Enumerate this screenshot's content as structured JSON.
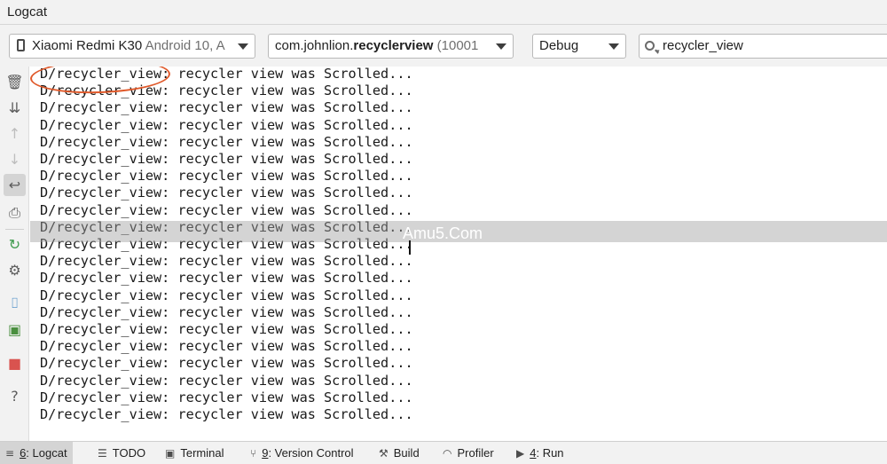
{
  "window": {
    "title": "Logcat"
  },
  "toolbar": {
    "device_name": "Xiaomi Redmi K30",
    "device_os": "Android 10, A",
    "process_prefix": "com.johnlion.",
    "process_bold": "recyclerview",
    "process_pid": "(10001",
    "log_level": "Debug",
    "filter_value": "recycler_view"
  },
  "sidebar": {
    "icons": [
      "trash-icon",
      "scroll-to-end-icon",
      "up-arrow-icon",
      "down-arrow-icon",
      "soft-wrap-icon",
      "print-icon",
      "restart-icon",
      "gear-icon",
      "camera-icon",
      "record-icon",
      "stop-icon",
      "help-icon"
    ]
  },
  "log": {
    "tag": "D/recycler_view:",
    "message": " recycler view was Scrolled...",
    "line_count": 21
  },
  "watermark": "Amu5.Com",
  "status_tabs": [
    {
      "key": "6",
      "label": ": Logcat",
      "icon": "≡"
    },
    {
      "key": "",
      "label": "TODO",
      "icon": "☰"
    },
    {
      "key": "",
      "label": "Terminal",
      "icon": "▣"
    },
    {
      "key": "9",
      "label": ": Version Control",
      "icon": "⑂"
    },
    {
      "key": "",
      "label": "Build",
      "icon": "⚒"
    },
    {
      "key": "",
      "label": "Profiler",
      "icon": "◠"
    },
    {
      "key": "4",
      "label": ": Run",
      "icon": "▶"
    }
  ]
}
